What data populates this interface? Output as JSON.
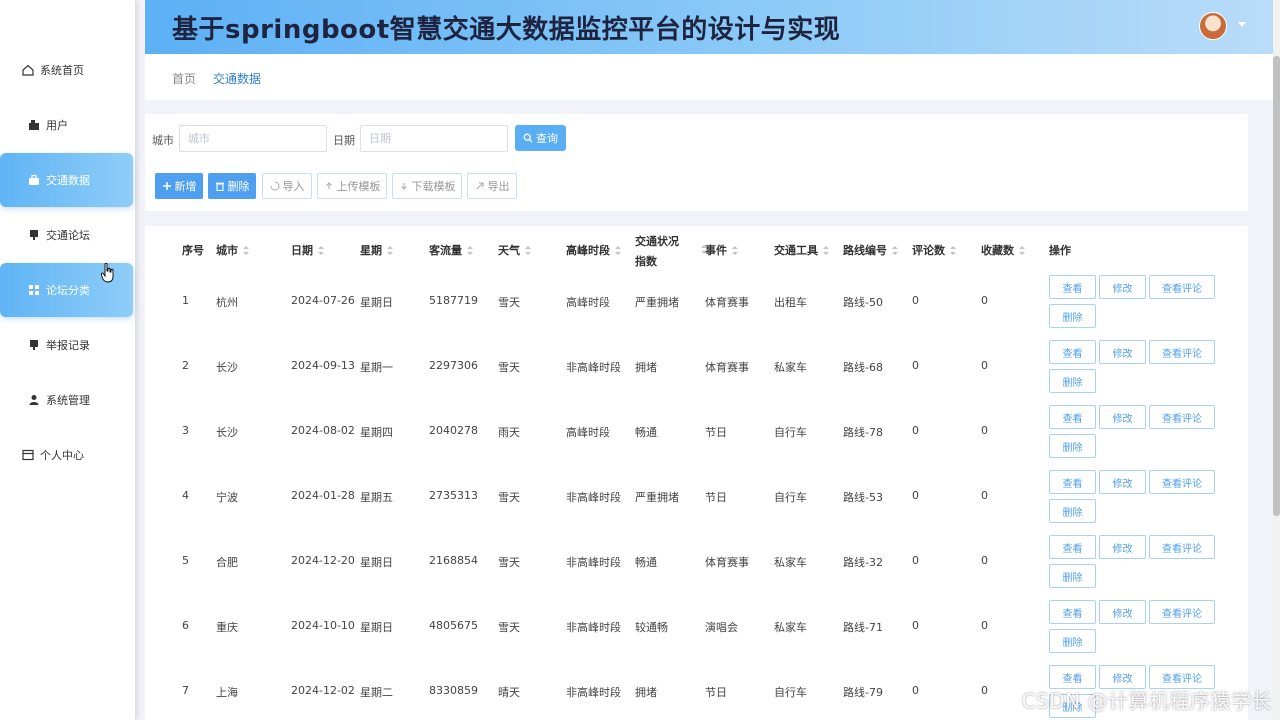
{
  "app": {
    "title": "基于springboot智慧交通大数据监控平台的设计与实现"
  },
  "sidebar": {
    "items": [
      {
        "label": "系统首页",
        "icon": "home-icon"
      },
      {
        "label": "用户",
        "icon": "user-icon"
      },
      {
        "label": "交通数据",
        "icon": "briefcase-icon",
        "active": true
      },
      {
        "label": "交通论坛",
        "icon": "monitor-icon"
      },
      {
        "label": "论坛分类",
        "icon": "grid-icon",
        "active": true
      },
      {
        "label": "举报记录",
        "icon": "monitor-icon"
      },
      {
        "label": "系统管理",
        "icon": "person-icon"
      },
      {
        "label": "个人中心",
        "icon": "window-icon"
      }
    ]
  },
  "breadcrumb": {
    "home": "首页",
    "current": "交通数据"
  },
  "search": {
    "city_label": "城市",
    "city_placeholder": "城市",
    "date_label": "日期",
    "date_placeholder": "日期",
    "query_button": "查询"
  },
  "toolbar": {
    "add": "新增",
    "delete": "删除",
    "import": "导入",
    "upload_template": "上传模板",
    "download_template": "下载模板",
    "export": "导出"
  },
  "table": {
    "columns": [
      "序号",
      "城市",
      "日期",
      "星期",
      "客流量",
      "天气",
      "高峰时段",
      "交通状况指数",
      "事件",
      "交通工具",
      "路线编号",
      "评论数",
      "收藏数",
      "操作"
    ],
    "actions": {
      "view": "查看",
      "edit": "修改",
      "view_comments": "查看评论",
      "delete": "删除"
    },
    "rows": [
      {
        "index": "1",
        "city": "杭州",
        "date": "2024-07-26",
        "weekday": "星期日",
        "flow": "5187719",
        "weather": "雪天",
        "peak": "高峰时段",
        "status": "严重拥堵",
        "event": "体育赛事",
        "vehicle": "出租车",
        "route": "路线-50",
        "comments": "0",
        "favorites": "0"
      },
      {
        "index": "2",
        "city": "长沙",
        "date": "2024-09-13",
        "weekday": "星期一",
        "flow": "2297306",
        "weather": "雪天",
        "peak": "非高峰时段",
        "status": "拥堵",
        "event": "体育赛事",
        "vehicle": "私家车",
        "route": "路线-68",
        "comments": "0",
        "favorites": "0"
      },
      {
        "index": "3",
        "city": "长沙",
        "date": "2024-08-02",
        "weekday": "星期四",
        "flow": "2040278",
        "weather": "雨天",
        "peak": "高峰时段",
        "status": "畅通",
        "event": "节日",
        "vehicle": "自行车",
        "route": "路线-78",
        "comments": "0",
        "favorites": "0"
      },
      {
        "index": "4",
        "city": "宁波",
        "date": "2024-01-28",
        "weekday": "星期五",
        "flow": "2735313",
        "weather": "雪天",
        "peak": "非高峰时段",
        "status": "严重拥堵",
        "event": "节日",
        "vehicle": "自行车",
        "route": "路线-53",
        "comments": "0",
        "favorites": "0"
      },
      {
        "index": "5",
        "city": "合肥",
        "date": "2024-12-20",
        "weekday": "星期日",
        "flow": "2168854",
        "weather": "雪天",
        "peak": "非高峰时段",
        "status": "畅通",
        "event": "体育赛事",
        "vehicle": "私家车",
        "route": "路线-32",
        "comments": "0",
        "favorites": "0"
      },
      {
        "index": "6",
        "city": "重庆",
        "date": "2024-10-10",
        "weekday": "星期日",
        "flow": "4805675",
        "weather": "雪天",
        "peak": "非高峰时段",
        "status": "较通畅",
        "event": "演唱会",
        "vehicle": "私家车",
        "route": "路线-71",
        "comments": "0",
        "favorites": "0"
      },
      {
        "index": "7",
        "city": "上海",
        "date": "2024-12-02",
        "weekday": "星期二",
        "flow": "8330859",
        "weather": "晴天",
        "peak": "非高峰时段",
        "status": "拥堵",
        "event": "节日",
        "vehicle": "自行车",
        "route": "路线-79",
        "comments": "0",
        "favorites": "0"
      }
    ]
  },
  "watermark": "CSDN @计算机程序猿学长",
  "colors": {
    "accent": "#4f9ff0",
    "header_start": "#5db0f5",
    "active_menu": "#5fb4f5"
  }
}
